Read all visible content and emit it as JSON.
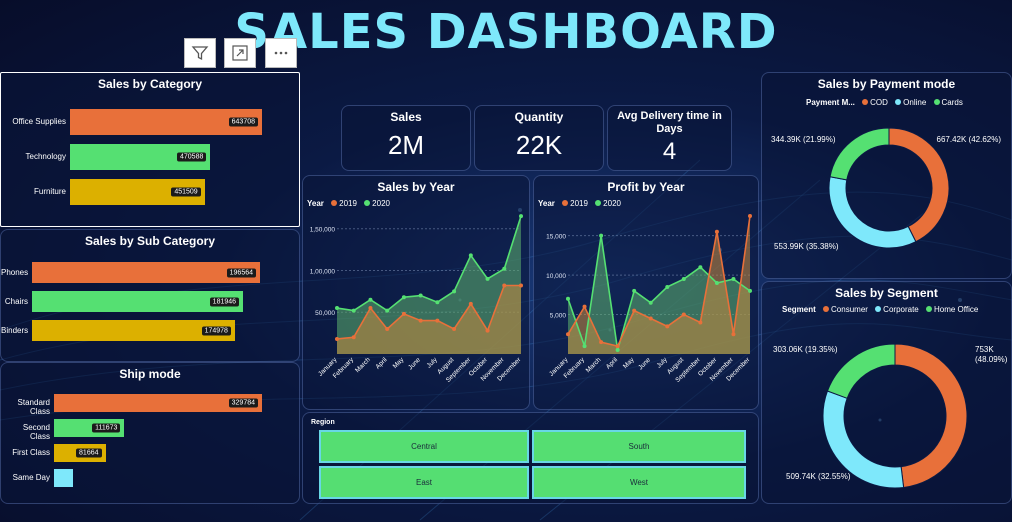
{
  "title": "SALES DASHBOARD",
  "colors": {
    "orange": "#e8703a",
    "green": "#55e072",
    "gold": "#dcb000",
    "cyan": "#7ee8fb"
  },
  "toolbar": {
    "filter_icon": "filter-icon",
    "expand_icon": "expand-icon",
    "more_icon": "more-icon"
  },
  "category": {
    "title": "Sales by Category",
    "items": [
      {
        "label": "Office Supplies",
        "value": 643708,
        "value_text": "643708"
      },
      {
        "label": "Technology",
        "value": 470588,
        "value_text": "470588"
      },
      {
        "label": "Furniture",
        "value": 451509,
        "value_text": "451509"
      }
    ]
  },
  "subcategory": {
    "title": "Sales by Sub Category",
    "items": [
      {
        "label": "Phones",
        "value": 196564,
        "value_text": "196564"
      },
      {
        "label": "Chairs",
        "value": 181946,
        "value_text": "181946"
      },
      {
        "label": "Binders",
        "value": 174978,
        "value_text": "174978"
      }
    ]
  },
  "shipmode": {
    "title": "Ship mode",
    "items": [
      {
        "label": "Standard Class",
        "value": 329784,
        "value_text": "329784"
      },
      {
        "label": "Second Class",
        "value": 111673,
        "value_text": "111673"
      },
      {
        "label": "First Class",
        "value": 81664,
        "value_text": "81664"
      },
      {
        "label": "Same Day",
        "value": 30000,
        "value_text": ""
      }
    ]
  },
  "kpis": [
    {
      "title": "Sales",
      "value": "2M"
    },
    {
      "title": "Quantity",
      "value": "22K"
    },
    {
      "title": "Avg Delivery time in Days",
      "value": "4"
    }
  ],
  "legend_year": {
    "label": "Year",
    "items": [
      "2019",
      "2020"
    ]
  },
  "chart_data": [
    {
      "type": "area",
      "title": "Sales by Year",
      "categories": [
        "January",
        "February",
        "March",
        "April",
        "May",
        "June",
        "July",
        "August",
        "September",
        "October",
        "November",
        "December"
      ],
      "ylim": [
        0,
        170000
      ],
      "yticks": [
        "50,000",
        "1,00,000",
        "1,50,000"
      ],
      "series": [
        {
          "name": "2019",
          "values": [
            18000,
            20000,
            55000,
            30000,
            48000,
            40000,
            40000,
            30000,
            60000,
            28000,
            82000,
            82000
          ]
        },
        {
          "name": "2020",
          "values": [
            55000,
            52000,
            65000,
            52000,
            68000,
            70000,
            62000,
            75000,
            118000,
            90000,
            102000,
            165000
          ]
        }
      ]
    },
    {
      "type": "area",
      "title": "Profit by Year",
      "categories": [
        "January",
        "February",
        "March",
        "April",
        "May",
        "June",
        "July",
        "August",
        "September",
        "October",
        "November",
        "December"
      ],
      "ylim": [
        0,
        18000
      ],
      "yticks": [
        "5,000",
        "10,000",
        "15,000"
      ],
      "series": [
        {
          "name": "2019",
          "values": [
            2500,
            6000,
            1500,
            1000,
            5500,
            4500,
            3500,
            5000,
            4000,
            15500,
            2500,
            17500
          ]
        },
        {
          "name": "2020",
          "values": [
            7000,
            1000,
            15000,
            500,
            8000,
            6500,
            8500,
            9500,
            11000,
            9000,
            9500,
            8000
          ]
        }
      ]
    },
    {
      "type": "pie",
      "title": "Sales by Payment mode",
      "legend_label": "Payment M...",
      "slices": [
        {
          "name": "COD",
          "value": 667420,
          "label": "667.42K (42.62%)"
        },
        {
          "name": "Online",
          "value": 553990,
          "label": "553.99K (35.38%)"
        },
        {
          "name": "Cards",
          "value": 344390,
          "label": "344.39K (21.99%)"
        }
      ]
    },
    {
      "type": "pie",
      "title": "Sales by Segment",
      "legend_label": "Segment",
      "slices": [
        {
          "name": "Consumer",
          "value": 753000,
          "label": "753K (48.09%)"
        },
        {
          "name": "Corporate",
          "value": 509740,
          "label": "509.74K (32.55%)"
        },
        {
          "name": "Home Office",
          "value": 303060,
          "label": "303.06K (19.35%)"
        }
      ]
    }
  ],
  "region": {
    "title": "Region",
    "tiles": [
      "Central",
      "South",
      "East",
      "West"
    ]
  }
}
